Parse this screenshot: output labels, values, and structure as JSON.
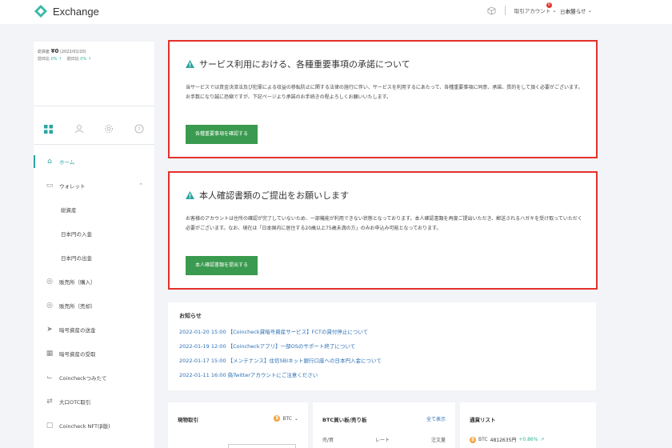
{
  "header": {
    "logo_text": "Exchange",
    "account_label": "取引アカウント",
    "account_badge": "0",
    "notice_label": "お知らせ",
    "lang_label": "日本語"
  },
  "sidebar": {
    "balance_label": "総資産",
    "balance_value": "¥0",
    "balance_date": "(2022/01/20)",
    "change_day_label": "前日比",
    "change_day_value": "0% ↑",
    "change_month_label": "前日比",
    "change_month_value": "0% ↑",
    "nav": [
      {
        "label": "ホーム",
        "icon": "home-icon"
      },
      {
        "label": "ウォレット",
        "icon": "wallet-icon"
      },
      {
        "label": "総資産"
      },
      {
        "label": "日本円の入金"
      },
      {
        "label": "日本円の出金"
      },
      {
        "label": "販売所（購入）",
        "icon": "buy-icon"
      },
      {
        "label": "販売所（売却）",
        "icon": "sell-icon"
      },
      {
        "label": "暗号資産の送金",
        "icon": "send-icon"
      },
      {
        "label": "暗号資産の受取",
        "icon": "qr-icon"
      },
      {
        "label": "Coincheckつみたて",
        "icon": "chart-icon"
      },
      {
        "label": "大口OTC取引",
        "icon": "otc-icon"
      },
      {
        "label": "Coincheck NFT(β版)",
        "icon": "nft-icon"
      }
    ]
  },
  "notice1": {
    "title": "サービス利用における、各種重要事項の承諾について",
    "body": "当サービスでは資金決済法及び犯罪による収益の移転防止に関する法律の施行に伴い、サービスを利用するにあたって、各種重要事項に同意、承諾、質的をして頂く必要がございます。お手数になり誠に恐縮ですが、下記ページより承諾のお手続きの程よろしくお願いいたします。",
    "button": "各種重要事項を確認する"
  },
  "notice2": {
    "title": "本人確認書類のご提出をお願いします",
    "body": "お客様のアカウントは住所の確認が完了していないため、一部機能が利用できない状態となっております。本人確認書類を再度ご提出いただき、郵送されるハガキを受け取っていただく必要がございます。なお、現在は「日本国内に居住する20歳以上75歳未満の方」のみお申込み可能となっております。",
    "button": "本人確認書類を提出する"
  },
  "news": {
    "title": "お知らせ",
    "items": [
      "2022-01-20 15:00 【Coincheck貸暗号資産サービス】FCTの貸付停止について",
      "2022-01-19 12:00 【Coincheckアプリ】一部OSのサポート終了について",
      "2022-01-17 15:00 【メンテナンス】住信SBIネット銀行口座への日本円入金について",
      "2022-01-11 16:00 偽Twitterアカウントにご注意ください"
    ]
  },
  "panels": {
    "trade_title": "現物取引",
    "trade_coin": "BTC",
    "orderbook_title": "BTC買い板/売り板",
    "orderbook_link": "全て表示",
    "col_side": "売/買",
    "col_rate": "レート",
    "col_qty": "注文量",
    "currency_title": "通貨リスト",
    "currency_symbol": "BTC",
    "currency_price": "4812635円",
    "currency_change": "+0.86%"
  },
  "colors": {
    "accent": "#2aa5a0",
    "alert_border": "#e4312b",
    "button": "#3a9a4f",
    "link": "#2a6fb5"
  }
}
